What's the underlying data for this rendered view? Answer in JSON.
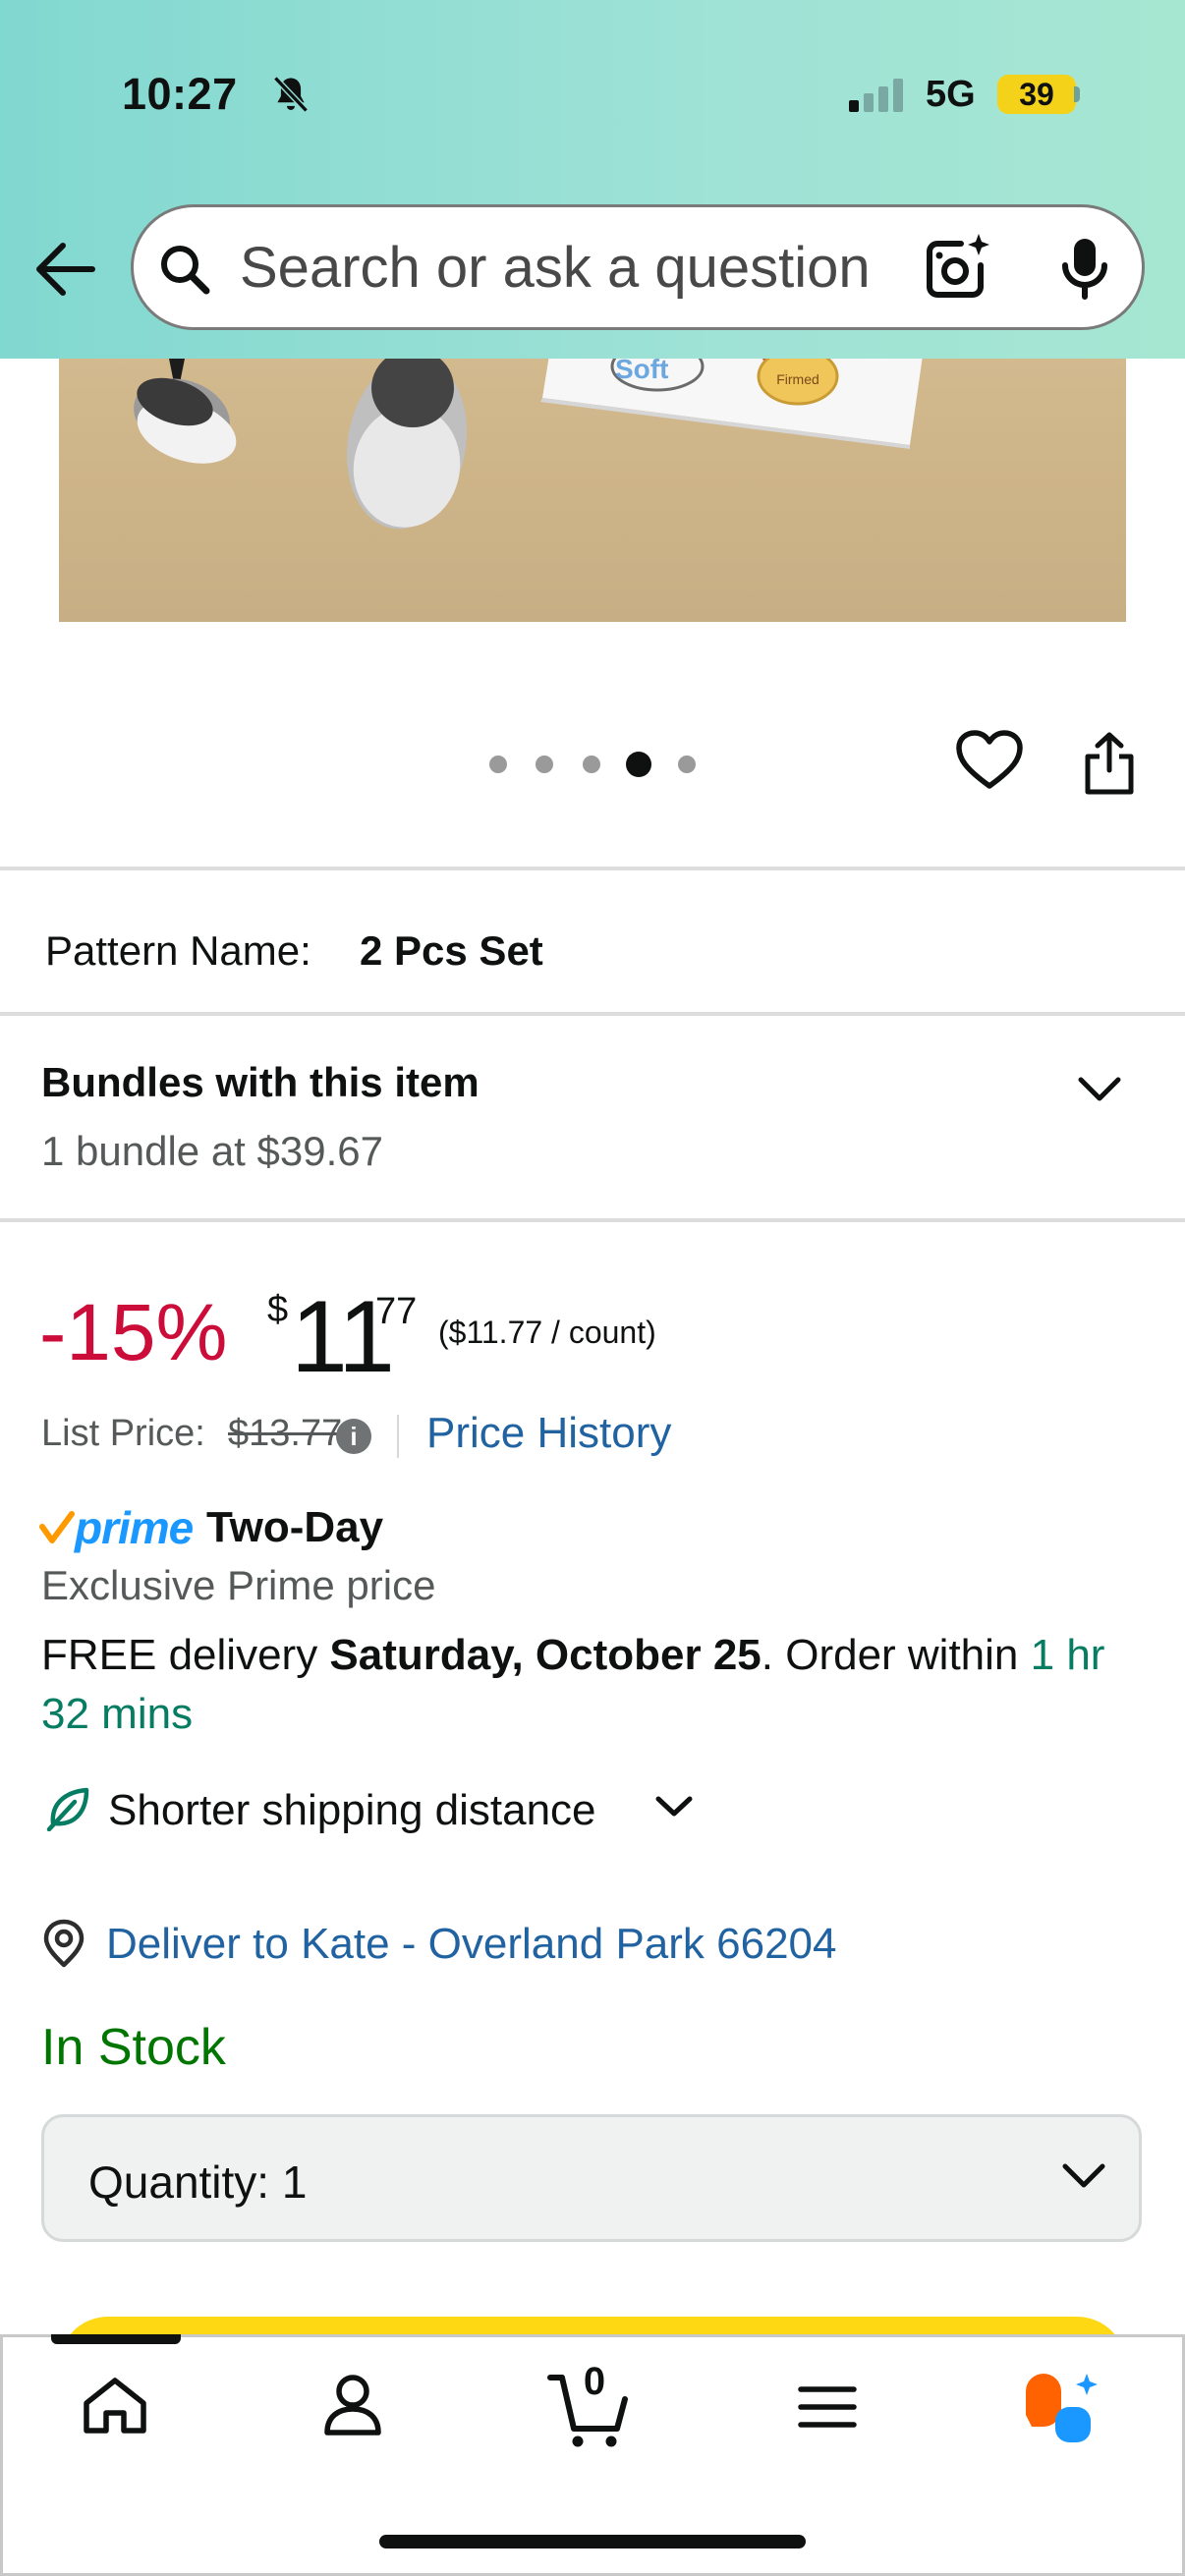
{
  "status_bar": {
    "time": "10:27",
    "network": "5G",
    "battery": "39"
  },
  "search": {
    "placeholder": "Search or ask a question"
  },
  "gallery": {
    "image_count": 5,
    "active_index": 3,
    "card_text": "Firmed",
    "card_text_soft": "Soft"
  },
  "variant": {
    "label": "Pattern Name:",
    "value": "2 Pcs Set"
  },
  "bundles": {
    "title": "Bundles with this item",
    "subtitle": "1 bundle at $39.67"
  },
  "price": {
    "discount": "-15%",
    "currency": "$",
    "whole": "11",
    "fraction": "77",
    "unit_price": "($11.77 / count)",
    "list_label": "List Price:",
    "list_value": "$13.77",
    "info": "i",
    "history_link": "Price History"
  },
  "prime": {
    "badge": "prime",
    "speed": "Two-Day",
    "exclusive": "Exclusive Prime price"
  },
  "delivery": {
    "prefix": "FREE delivery ",
    "date": "Saturday, October 25",
    "middle": ". Order within ",
    "countdown_a": "1 hr",
    "countdown_b": "32 mins"
  },
  "shipping": {
    "label": "Shorter shipping distance"
  },
  "location": {
    "label": "Deliver to Kate - Overland Park 66204"
  },
  "stock": {
    "status": "In Stock"
  },
  "quantity": {
    "label": "Quantity: 1"
  },
  "nav": {
    "cart_count": "0"
  },
  "colors": {
    "discount": "#cc0c39",
    "link": "#2162a1",
    "in_stock": "#007600",
    "teal": "#067d62",
    "prime_blue": "#1a98ff",
    "buy_yellow": "#ffd814",
    "rufus_orange": "#ff6200"
  }
}
